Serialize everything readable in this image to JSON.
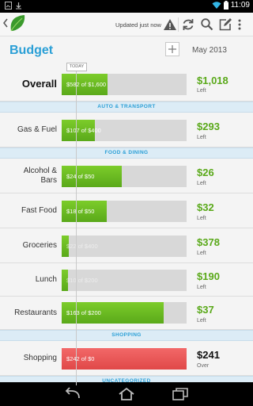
{
  "status_bar": {
    "time": "11:09"
  },
  "action_bar": {
    "updated_text": "Updated just now"
  },
  "header": {
    "title": "Budget",
    "month": "May 2013",
    "add_label": "+"
  },
  "timeline": {
    "today_label": "TODAY"
  },
  "overall": {
    "label": "Overall",
    "bar_text": "$582 of $1,600",
    "progress": 0.364,
    "amount": "$1,018",
    "amount_sub": "Left"
  },
  "sections": [
    {
      "title": "AUTO & TRANSPORT",
      "rows": [
        {
          "label": "Gas & Fuel",
          "bar_text": "$107 of $400",
          "progress": 0.268,
          "amount": "$293",
          "amount_sub": "Left",
          "over": false
        }
      ]
    },
    {
      "title": "FOOD & DINING",
      "rows": [
        {
          "label": "Alcohol & Bars",
          "bar_text": "$24 of $50",
          "progress": 0.48,
          "amount": "$26",
          "amount_sub": "Left",
          "over": false
        },
        {
          "label": "Fast Food",
          "bar_text": "$18 of $50",
          "progress": 0.36,
          "amount": "$32",
          "amount_sub": "Left",
          "over": false
        },
        {
          "label": "Groceries",
          "bar_text": "$22 of $400",
          "progress": 0.055,
          "amount": "$378",
          "amount_sub": "Left",
          "over": false
        },
        {
          "label": "Lunch",
          "bar_text": "$10 of $200",
          "progress": 0.05,
          "amount": "$190",
          "amount_sub": "Left",
          "over": false
        },
        {
          "label": "Restaurants",
          "bar_text": "$163 of $200",
          "progress": 0.815,
          "amount": "$37",
          "amount_sub": "Left",
          "over": false
        }
      ]
    },
    {
      "title": "SHOPPING",
      "rows": [
        {
          "label": "Shopping",
          "bar_text": "$242 of $0",
          "progress": 1.0,
          "amount": "$241",
          "amount_sub": "Over",
          "over": true
        }
      ]
    },
    {
      "title": "UNCATEGORIZED",
      "rows": []
    }
  ],
  "colors": {
    "accent": "#2a9fd6",
    "positive": "#5aa91a",
    "over": "#e04848",
    "track": "#d8d8d8"
  },
  "icons": [
    "wifi-icon",
    "battery-icon",
    "back-chevron-icon",
    "mint-leaf-logo",
    "alert-icon",
    "refresh-icon",
    "search-icon",
    "compose-icon",
    "overflow-menu-icon",
    "nav-back-icon",
    "nav-home-icon",
    "nav-recents-icon"
  ]
}
